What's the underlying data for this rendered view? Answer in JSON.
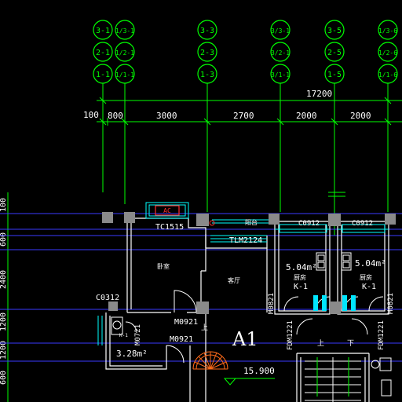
{
  "axis_bubbles": {
    "c1": [
      "3-1",
      "2-1",
      "1-1"
    ],
    "c2": [
      "1/3-1",
      "1/2-1",
      "1/1-1"
    ],
    "c3": [
      "3-3",
      "2-3",
      "1-3"
    ],
    "c4": [
      "3/3-1",
      "3/2-1",
      "3/1-1"
    ],
    "c5": [
      "3-5",
      "2-5",
      "1-5"
    ],
    "c6": [
      "1/3-6",
      "1/2-6",
      "1/1-6"
    ]
  },
  "dimensions": {
    "total": "17200",
    "segments": [
      "100",
      "800",
      "3000",
      "2700",
      "2000",
      "2000"
    ],
    "vertical": [
      "100",
      "600",
      "2400",
      "1200",
      "1200",
      "600"
    ]
  },
  "labels": {
    "ac": "AC",
    "window_tc": "TC1515",
    "door_tlm": "TLM2124",
    "window_c0312": "C0312",
    "window_c0912_a": "C0912",
    "window_c0912_b": "C0912",
    "door_m0921_a": "M0921",
    "door_m0921_b": "M0921",
    "door_m0721": "M0721",
    "door_m0821_a": "M0821",
    "door_m0821_b": "M0821",
    "door_fdm_a": "FDM1221",
    "door_fdm_b": "FDM1221",
    "area_kitchen_a": "5.04m²",
    "area_kitchen_b": "5.04m²",
    "area_bath": "3.28m²",
    "kitchen_tag_a": "K-1",
    "kitchen_tag_b": "K-1",
    "bath_tag": "K-1",
    "kitchen_name_a": "厨房",
    "kitchen_name_b": "厨房",
    "bedroom": "卧室",
    "living": "客厅",
    "balcony": "阳台",
    "unit": "A1",
    "elevation": "15.900",
    "up_a": "上",
    "up_b": "上",
    "down": "下"
  },
  "colors": {
    "background": "#000000",
    "axis": "#00ff00",
    "wall": "#ffffff",
    "window": "#00ffff",
    "dimension": "#00ff00",
    "text": "#ffffff",
    "gridline": "#3a3aff",
    "accent_red": "#ff3030",
    "stair": "#ff6a1a",
    "column": "#8a8a8a",
    "fixture": "#00e5ff"
  }
}
